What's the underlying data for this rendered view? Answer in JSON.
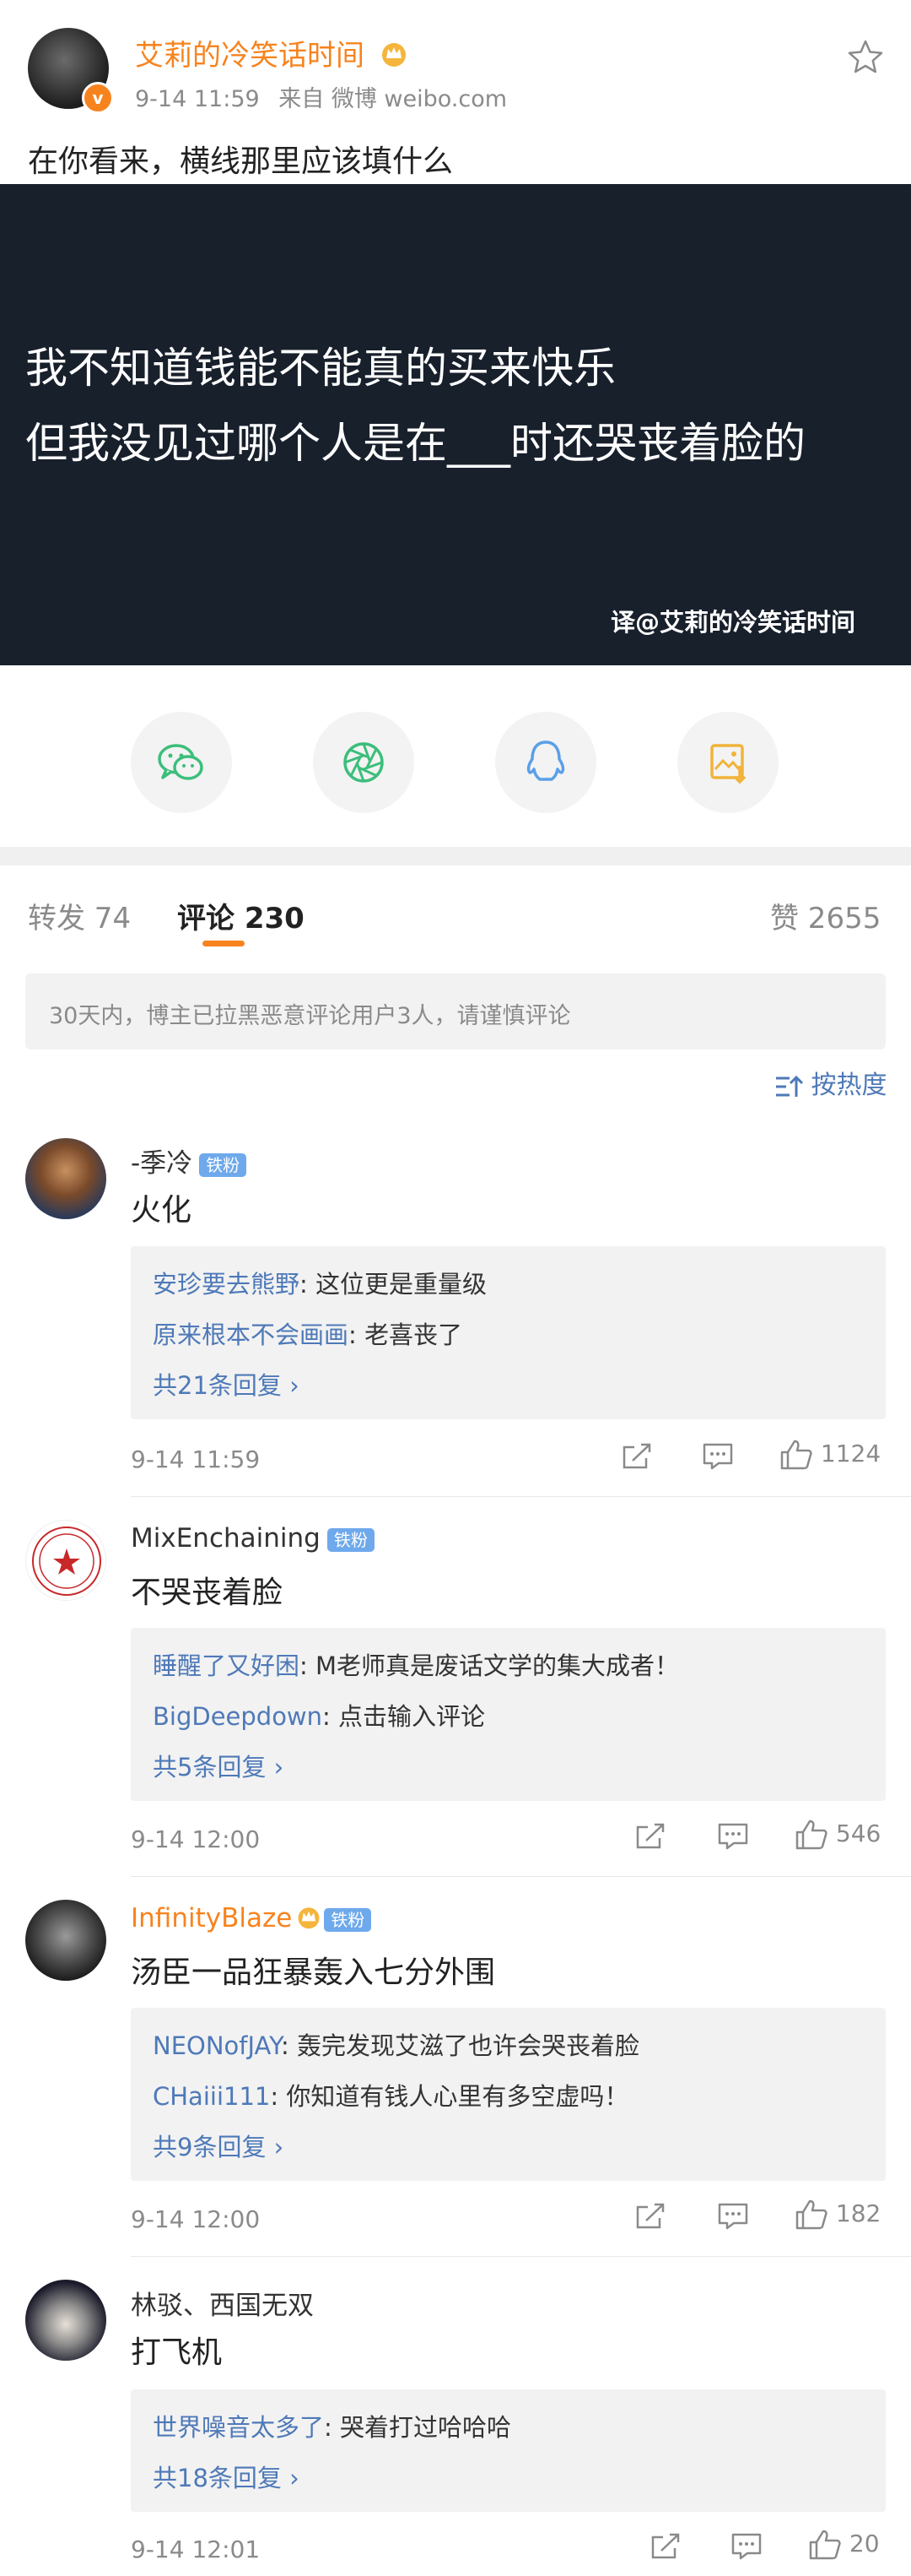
{
  "post": {
    "author": "艾莉的冷笑话时间",
    "time": "9-14 11:59",
    "source": "来自 微博 weibo.com",
    "text": "在你看来，横线那里应该填什么",
    "image": {
      "line1": "我不知道钱能不能真的买来快乐",
      "line2": "但我没见过哪个人是在___时还哭丧着脸的",
      "credit": "译@艾莉的冷笑话时间"
    }
  },
  "tabs": {
    "repost": "转发 74",
    "comments": "评论 230",
    "likes": "赞 2655"
  },
  "notice": "30天内，博主已拉黑恶意评论用户3人，请谨慎评论",
  "sort_label": "按热度",
  "comments": [
    {
      "name": "-季冷",
      "badge": "铁粉",
      "text": "火化",
      "replies": [
        {
          "name": "安珍要去熊野",
          "text": ": 这位更是重量级"
        },
        {
          "name": "原来根本不会画画",
          "text": ": 老喜丧了"
        }
      ],
      "more": "共21条回复 ›",
      "time": "9-14 11:59",
      "likes": "1124"
    },
    {
      "name": "MixEnchaining",
      "badge": "铁粉",
      "text": "不哭丧着脸",
      "replies": [
        {
          "name": "睡醒了又好困",
          "text": ": M老师真是废话文学的集大成者！"
        },
        {
          "name": "BigDeepdown",
          "text": ": 点击输入评论"
        }
      ],
      "more": "共5条回复 ›",
      "time": "9-14 12:00",
      "likes": "546"
    },
    {
      "name": "InfinityBlaze",
      "badge": "铁粉",
      "text": "汤臣一品狂暴轰入七分外围",
      "replies": [
        {
          "name": "NEONofJAY",
          "text": ": 轰完发现艾滋了也许会哭丧着脸"
        },
        {
          "name": "CHaiii111",
          "text": ": 你知道有钱人心里有多空虚吗！"
        }
      ],
      "more": "共9条回复 ›",
      "time": "9-14 12:00",
      "likes": "182"
    },
    {
      "name": "林驳、西国无双",
      "badge": "",
      "text": "打飞机",
      "replies": [
        {
          "name": "世界噪音太多了",
          "text": ": 哭着打过哈哈哈"
        }
      ],
      "more": "共18条回复 ›",
      "time": "9-14 12:01",
      "likes": "20"
    }
  ],
  "colors": {
    "orange": "#f7831e",
    "banner": "#18202c",
    "link": "#4e79b8",
    "badge": "#6ea9ec",
    "wechat": "#3cbe7b",
    "qq": "#5b9fe7",
    "save": "#f1b33a"
  },
  "icons": [
    "star-icon",
    "verified-icon",
    "crown-icon",
    "wechat-icon",
    "moments-icon",
    "qq-icon",
    "save-image-icon",
    "sort-icon",
    "repost-icon",
    "comment-icon",
    "like-icon"
  ]
}
